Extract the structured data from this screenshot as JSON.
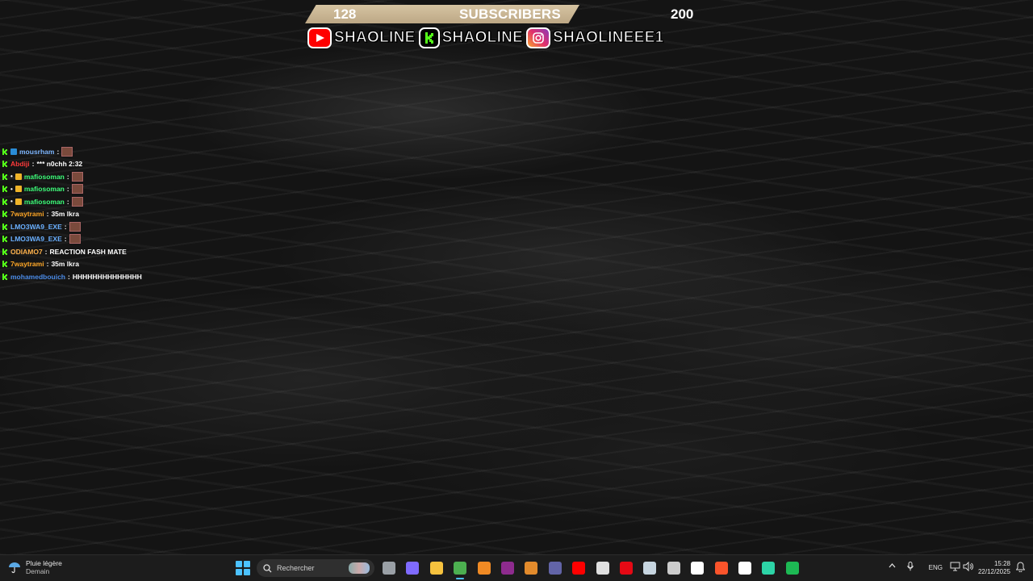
{
  "overlay": {
    "goal": {
      "current": "128",
      "label": "SUBSCRIBERS",
      "target": "200"
    },
    "socials": [
      {
        "platform": "youtube-icon",
        "name": "SHAOLINE",
        "color": "#ff0000"
      },
      {
        "platform": "kick-icon",
        "name": "SHAOLINE",
        "color": "#53fc18"
      },
      {
        "platform": "instagram-icon",
        "name": "SHAOLINEEE1",
        "color": "#e1306c"
      }
    ]
  },
  "chat": {
    "messages": [
      {
        "user": "mousrham",
        "user_color": "#7fb7ff",
        "badge": "verified",
        "text": "",
        "emote": true
      },
      {
        "user": "Abdiji",
        "user_color": "#ff3b3b",
        "badge": "",
        "text": "*** n0chh 2:32",
        "emote": false
      },
      {
        "user": "mafiosoman",
        "user_color": "#3dff7a",
        "badge": "sub",
        "text": "",
        "emote": true
      },
      {
        "user": "mafiosoman",
        "user_color": "#3dff7a",
        "badge": "sub",
        "text": "",
        "emote": true
      },
      {
        "user": "mafiosoman",
        "user_color": "#3dff7a",
        "badge": "sub",
        "text": "",
        "emote": true
      },
      {
        "user": "7waytrami",
        "user_color": "#ffa726",
        "badge": "",
        "text": "35m lkra",
        "emote": false
      },
      {
        "user": "LMO3WA9_EXE",
        "user_color": "#6ab0ff",
        "badge": "",
        "text": "",
        "emote": true
      },
      {
        "user": "LMO3WA9_EXE",
        "user_color": "#6ab0ff",
        "badge": "",
        "text": "",
        "emote": true
      },
      {
        "user": "ODIAMO7",
        "user_color": "#ffb34d",
        "badge": "",
        "text": "REACTION FASH MATE",
        "emote": false
      },
      {
        "user": "7waytrami",
        "user_color": "#ffa726",
        "badge": "",
        "text": "35m lkra",
        "emote": false
      },
      {
        "user": "mohamedbouich",
        "user_color": "#4b8ce8",
        "badge": "",
        "text": "HHHHHHHHHHHHHH",
        "emote": false
      }
    ]
  },
  "taskbar": {
    "weather": {
      "icon": "rain-umbrella-icon",
      "title": "Pluie légère",
      "subtitle": "Demain"
    },
    "search_placeholder": "Rechercher",
    "apps": [
      {
        "name": "task-view-icon",
        "color": "#9aa0a6"
      },
      {
        "name": "copilot-icon",
        "color": "#7f6bff"
      },
      {
        "name": "file-explorer-icon",
        "color": "#f6c23e"
      },
      {
        "name": "chrome-icon",
        "color": "#4caf50",
        "active": true
      },
      {
        "name": "app-orange-icon",
        "color": "#f08a24"
      },
      {
        "name": "app-purple-icon",
        "color": "#8e2b8e"
      },
      {
        "name": "app-shield-icon",
        "color": "#e38b2c"
      },
      {
        "name": "teams-icon",
        "color": "#6264a7"
      },
      {
        "name": "youtube-icon",
        "color": "#ff0000"
      },
      {
        "name": "fn-app-icon",
        "color": "#e0e0e0"
      },
      {
        "name": "netflix-icon",
        "color": "#e50914"
      },
      {
        "name": "steam-icon",
        "color": "#c7d5e0"
      },
      {
        "name": "app-circle-icon",
        "color": "#cccccc"
      },
      {
        "name": "xm-app-icon",
        "color": "#ffffff"
      },
      {
        "name": "brave-icon",
        "color": "#fb542b"
      },
      {
        "name": "tradingview-icon",
        "color": "#ffffff"
      },
      {
        "name": "app-teal-icon",
        "color": "#2dd4a7"
      },
      {
        "name": "spotify-icon",
        "color": "#1db954"
      }
    ],
    "tray": {
      "language": "ENG",
      "time": "15:28",
      "date": "22/12/2025"
    }
  }
}
